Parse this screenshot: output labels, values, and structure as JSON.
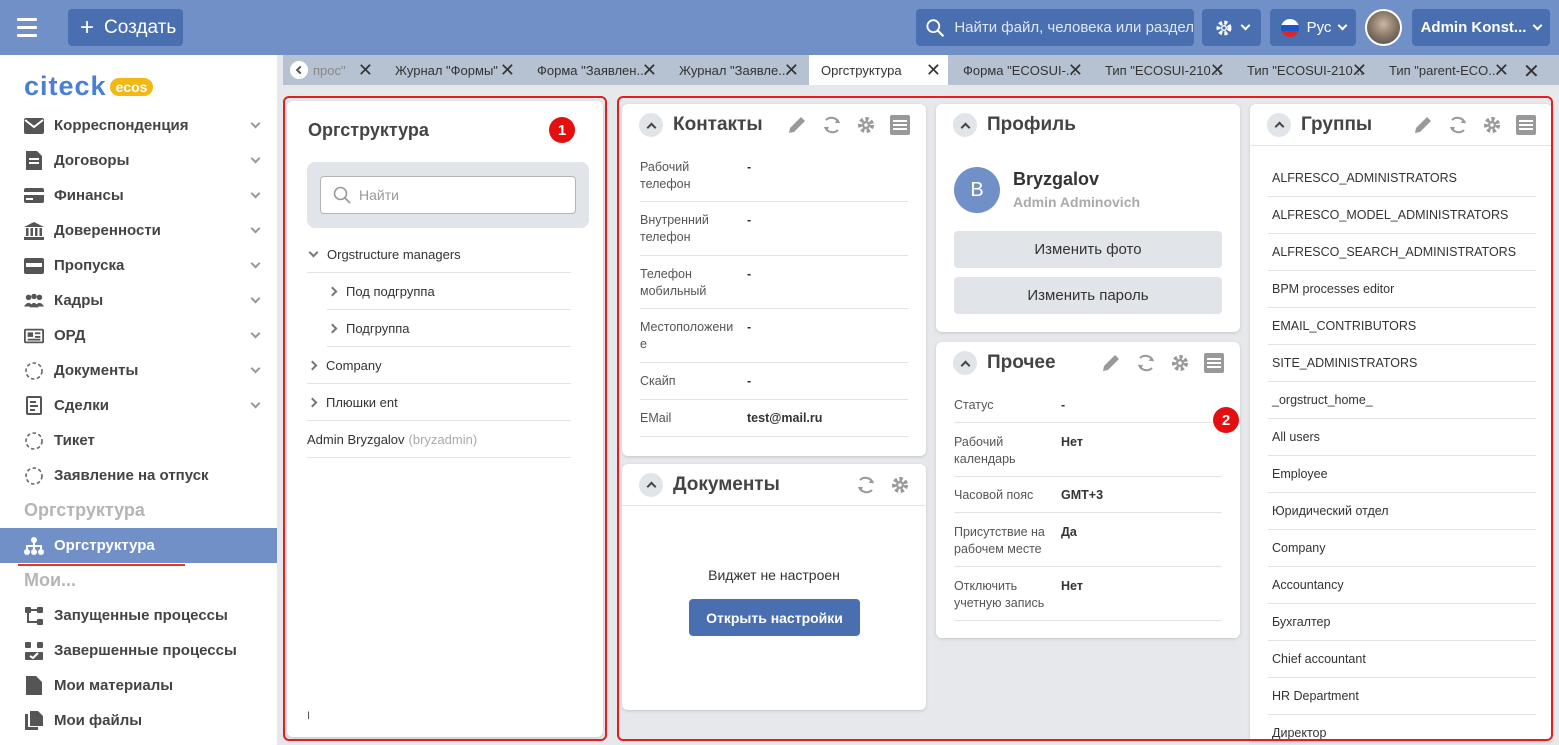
{
  "header": {
    "create_label": "Создать",
    "search_placeholder": "Найти файл, человека или раздел",
    "lang_label": "Рус",
    "user_label": "Admin Konst..."
  },
  "logo": {
    "text": "citeck",
    "badge": "ecos"
  },
  "sidebar": {
    "items": [
      {
        "label": "Корреспонденция",
        "icon": "envelope-icon"
      },
      {
        "label": "Договоры",
        "icon": "document-icon"
      },
      {
        "label": "Финансы",
        "icon": "card-icon"
      },
      {
        "label": "Доверенности",
        "icon": "bank-icon"
      },
      {
        "label": "Пропуска",
        "icon": "pass-icon"
      },
      {
        "label": "Кадры",
        "icon": "people-icon"
      },
      {
        "label": "ОРД",
        "icon": "newspaper-icon"
      },
      {
        "label": "Документы",
        "icon": "dashed-circle-icon"
      },
      {
        "label": "Сделки",
        "icon": "deal-icon"
      },
      {
        "label": "Тикет",
        "icon": "dashed-circle-icon"
      },
      {
        "label": "Заявление на отпуск",
        "icon": "dashed-circle-icon"
      }
    ],
    "section_org": "Оргструктура",
    "active_item": "Оргструктура",
    "section_my": "Мои...",
    "my_items": [
      {
        "label": "Запущенные процессы",
        "icon": "process-icon"
      },
      {
        "label": "Завершенные процессы",
        "icon": "process-done-icon"
      },
      {
        "label": "Мои материалы",
        "icon": "file-icon"
      },
      {
        "label": "Мои файлы",
        "icon": "files-icon"
      }
    ]
  },
  "tabs": [
    {
      "label": "прос\""
    },
    {
      "label": "Журнал \"Формы\""
    },
    {
      "label": "Форма \"Заявлен..."
    },
    {
      "label": "Журнал \"Заявле..."
    },
    {
      "label": "Оргструктура"
    },
    {
      "label": "Форма \"ECOSUI-..."
    },
    {
      "label": "Тип \"ECOSUI-210..."
    },
    {
      "label": "Тип \"ECOSUI-210..."
    },
    {
      "label": "Тип \"parent-ECO..."
    }
  ],
  "orgstructure": {
    "title": "Оргструктура",
    "badge": "1",
    "search_placeholder": "Найти",
    "tree": [
      {
        "label": "Orgstructure managers"
      },
      {
        "label": "Под подгруппа"
      },
      {
        "label": "Подгруппа"
      },
      {
        "label": "Company"
      },
      {
        "label": "Плюшки ent"
      }
    ],
    "user_name": "Admin Bryzgalov",
    "user_login": "(bryzadmin)",
    "cursor_char": "I"
  },
  "contacts": {
    "title": "Контакты",
    "rows": [
      {
        "key": "Рабочий телефон",
        "value": "-"
      },
      {
        "key": "Внутренний телефон",
        "value": "-"
      },
      {
        "key": "Телефон мобильный",
        "value": "-"
      },
      {
        "key": "Местоположени е",
        "value": "-"
      },
      {
        "key": "Скайп",
        "value": "-"
      },
      {
        "key": "EMail",
        "value": "test@mail.ru"
      }
    ]
  },
  "documents": {
    "title": "Документы",
    "empty_text": "Виджет не настроен",
    "open_settings": "Открыть настройки"
  },
  "profile": {
    "title": "Профиль",
    "avatar_letter": "B",
    "last_name": "Bryzgalov",
    "full_name": "Admin Adminovich",
    "change_photo": "Изменить фото",
    "change_password": "Изменить пароль"
  },
  "other": {
    "title": "Прочее",
    "badge": "2",
    "rows": [
      {
        "key": "Статус",
        "value": "-"
      },
      {
        "key": "Рабочий календарь",
        "value": "Нет"
      },
      {
        "key": "Часовой пояс",
        "value": "GMT+3"
      },
      {
        "key": "Присутствие на рабочем месте",
        "value": "Да"
      },
      {
        "key": "Отключить учетную запись",
        "value": "Нет"
      }
    ]
  },
  "groups": {
    "title": "Группы",
    "items": [
      "ALFRESCO_ADMINISTRATORS",
      "ALFRESCO_MODEL_ADMINISTRATORS",
      "ALFRESCO_SEARCH_ADMINISTRATORS",
      "BPM processes editor",
      "EMAIL_CONTRIBUTORS",
      "SITE_ADMINISTRATORS",
      "_orgstruct_home_",
      "All users",
      "Employee",
      "Юридический отдел",
      "Company",
      "Accountancy",
      "Бухгалтер",
      "Chief accountant",
      "HR Department",
      "Директор"
    ]
  },
  "colors": {
    "header": "#7190c8",
    "button": "#4a6fb0",
    "active": "#7190c8",
    "highlight": "#e02020"
  }
}
